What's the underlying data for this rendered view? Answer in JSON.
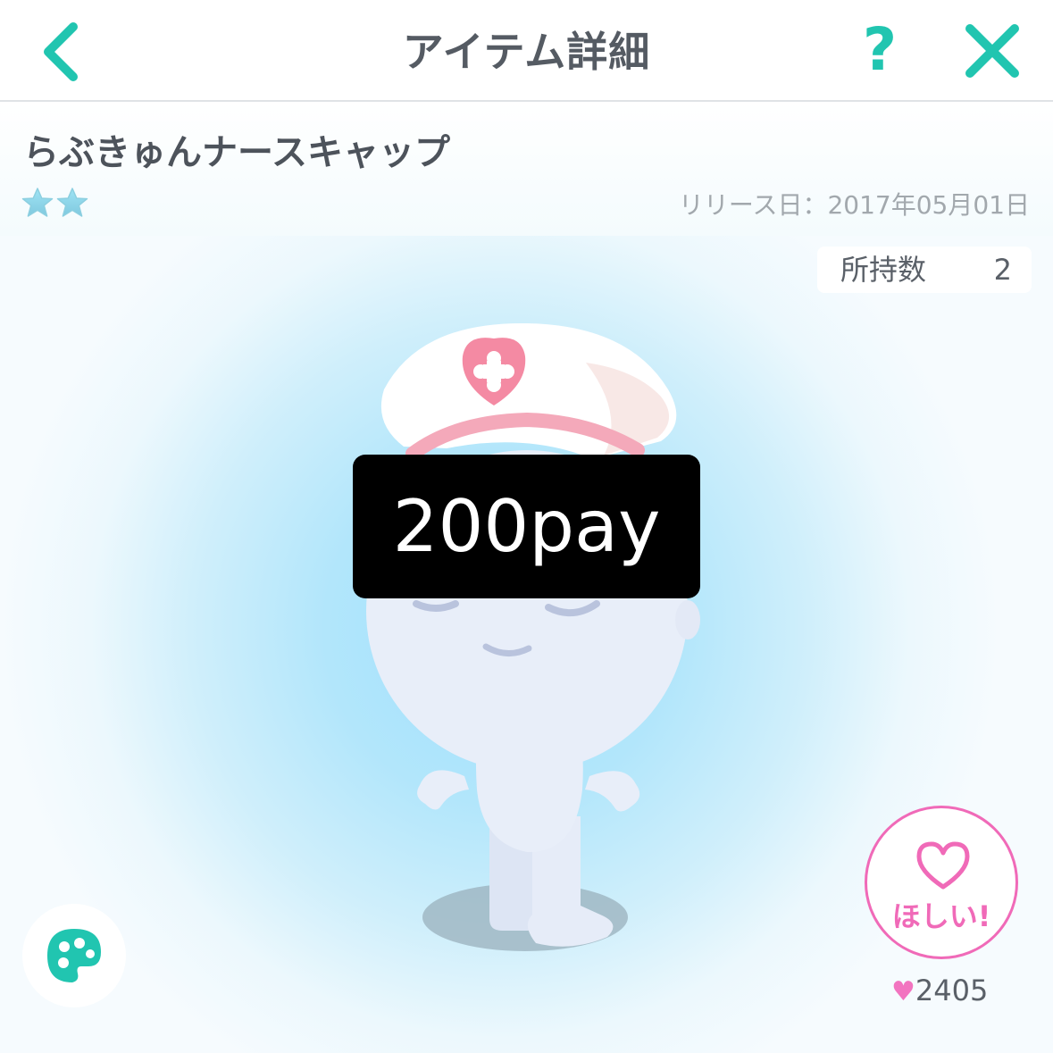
{
  "header": {
    "title": "アイテム詳細",
    "help_label": "?"
  },
  "item": {
    "name": "らぶきゅんナースキャップ",
    "rarity_stars": 2,
    "release": "リリース日：2017年05月01日"
  },
  "stage": {
    "owned_label": "所持数",
    "owned_count": "2",
    "price_badge": "200pay",
    "want_label": "ほしい!",
    "like_count": "2405"
  },
  "colors": {
    "accent": "#21c5b0",
    "pink": "#f06ab8",
    "badge_bg": "#000000"
  },
  "icons": {
    "back": "chevron-left-icon",
    "help": "question-icon",
    "close": "close-icon",
    "palette": "palette-icon",
    "want": "heart-outline-icon",
    "like": "heart-icon",
    "star": "star-icon"
  }
}
